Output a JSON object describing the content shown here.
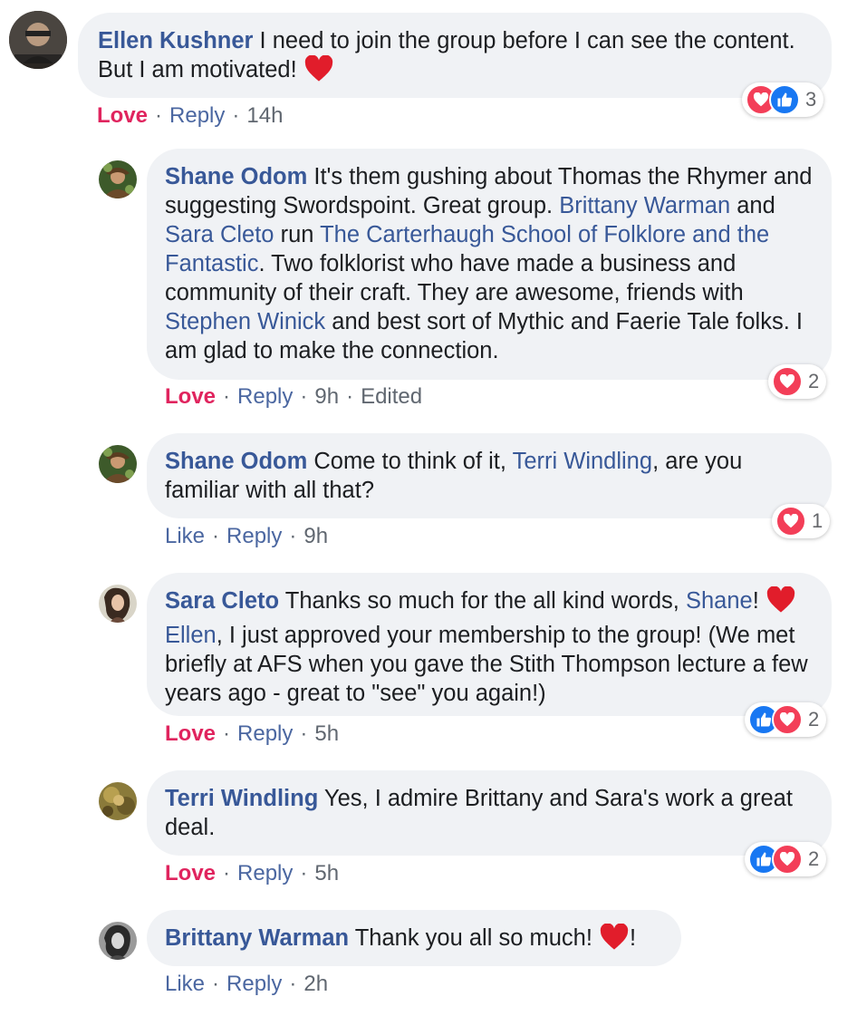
{
  "comments": [
    {
      "author": "Ellen Kushner",
      "text_1": "I need to join the group before I can see the content. But I am motivated!",
      "actions": {
        "reaction": "Love",
        "reply": "Reply",
        "time": "14h"
      },
      "reactions": {
        "count": "3",
        "icons": [
          "heart-icon",
          "like-icon"
        ]
      }
    },
    {
      "author": "Shane Odom",
      "text_1": "It's them gushing about Thomas the Rhymer and suggesting Swordspoint. Great group.",
      "mention_1": "Brittany Warman",
      "text_2": "and",
      "mention_2": "Sara Cleto",
      "text_3": "run",
      "mention_3": "The Carterhaugh School of Folklore and the Fantastic",
      "text_4": ". Two folklorist who have made a business and community of their craft. They are awesome, friends with",
      "mention_4": "Stephen Winick",
      "text_5": "and best sort of Mythic and Faerie Tale folks. I am glad to make the connection.",
      "actions": {
        "reaction": "Love",
        "reply": "Reply",
        "time": "9h",
        "edited": "Edited"
      },
      "reactions": {
        "count": "2",
        "icons": [
          "heart-icon"
        ]
      }
    },
    {
      "author": "Shane Odom",
      "text_1": "Come to think of it,",
      "mention_1": "Terri Windling",
      "text_2": ", are you familiar with all that?",
      "actions": {
        "reaction": "Like",
        "reply": "Reply",
        "time": "9h"
      },
      "reactions": {
        "count": "1",
        "icons": [
          "heart-icon"
        ]
      }
    },
    {
      "author": "Sara Cleto",
      "text_1": "Thanks so much for the all kind words,",
      "mention_1": "Shane",
      "text_2": "!",
      "mention_2": "Ellen",
      "text_3": ", I just approved your membership to the group! (We met briefly at AFS when you gave the Stith Thompson lecture a few years ago - great to \"see\" you again!)",
      "actions": {
        "reaction": "Love",
        "reply": "Reply",
        "time": "5h"
      },
      "reactions": {
        "count": "2",
        "icons": [
          "like-icon",
          "heart-icon"
        ]
      }
    },
    {
      "author": "Terri Windling",
      "text_1": "Yes, I admire Brittany and Sara's work a great deal.",
      "actions": {
        "reaction": "Love",
        "reply": "Reply",
        "time": "5h"
      },
      "reactions": {
        "count": "2",
        "icons": [
          "like-icon",
          "heart-icon"
        ]
      }
    },
    {
      "author": "Brittany Warman",
      "text_1": "Thank you all so much!",
      "text_2": "!",
      "actions": {
        "reaction": "Like",
        "reply": "Reply",
        "time": "2h"
      }
    }
  ],
  "colors": {
    "author": "#385898",
    "love": "#e0245e",
    "bubble": "#f0f2f5",
    "heart": "#f33e58",
    "like": "#1877f2"
  }
}
